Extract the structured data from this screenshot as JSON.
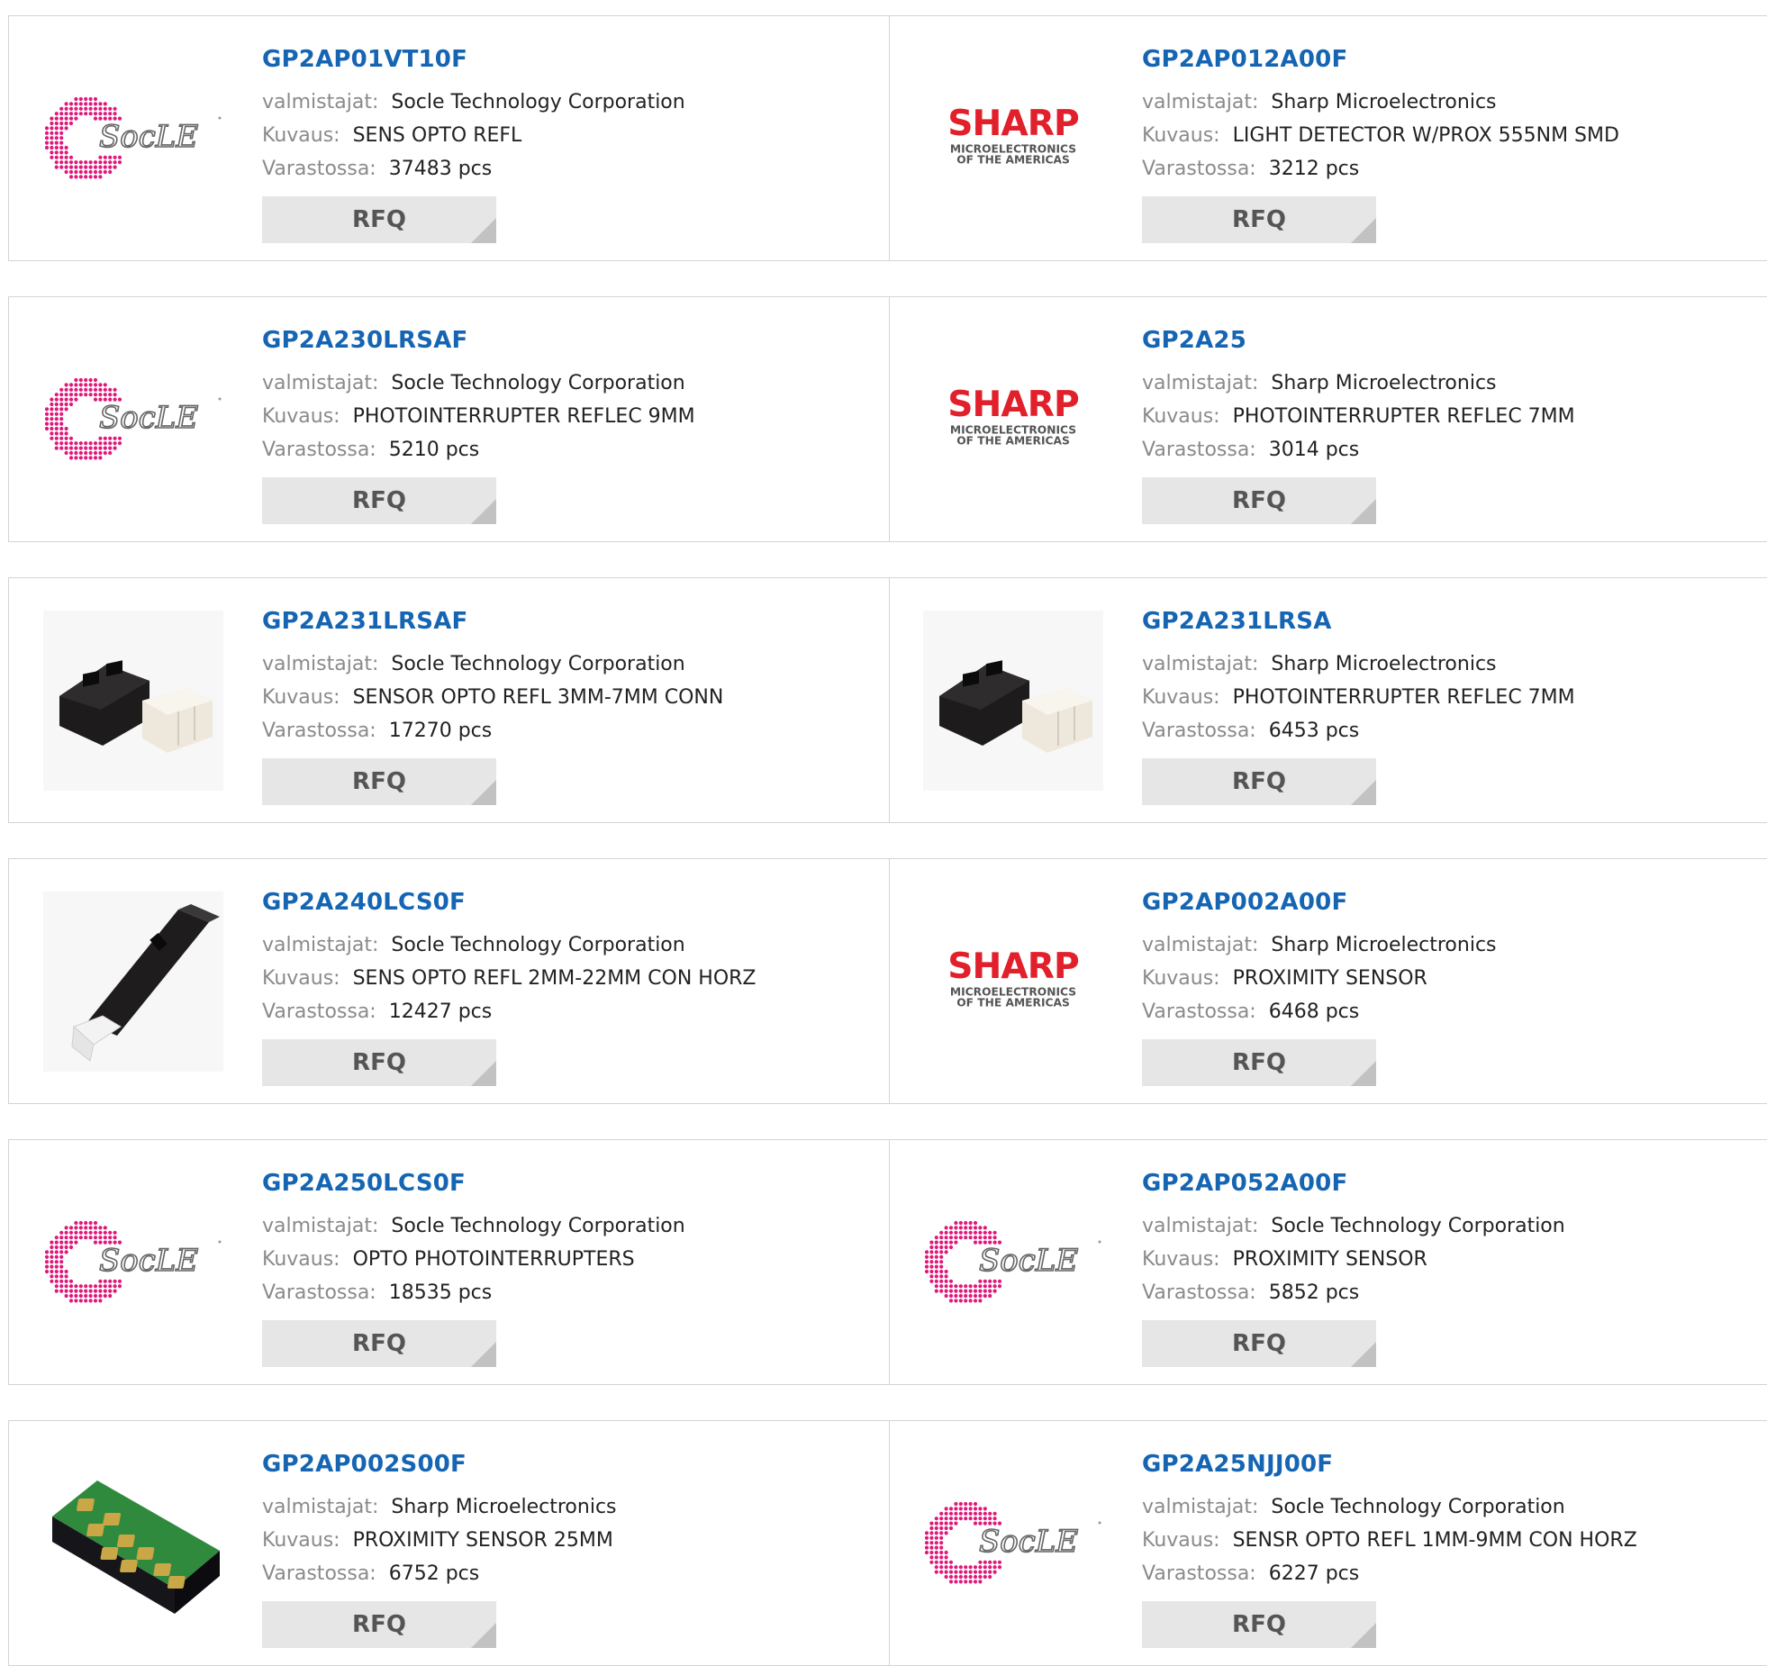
{
  "labels": {
    "manufacturer": "valmistajat:",
    "description": "Kuvaus:",
    "stock": "Varastossa:",
    "rfq": "RFQ"
  },
  "logos": {
    "socle": {
      "text": "SocLE",
      "dot_color": "#e0187a"
    },
    "sharp": {
      "word": "SHARP",
      "line1": "MICROELECTRONICS",
      "line2": "OF THE AMERICAS",
      "color": "#e1202b"
    }
  },
  "products": [
    {
      "pn": "GP2AP01VT10F",
      "manufacturer": "Socle Technology Corporation",
      "description": "SENS OPTO REFL",
      "stock": "37483 pcs",
      "image": "socle-logo"
    },
    {
      "pn": "GP2AP012A00F",
      "manufacturer": "Sharp Microelectronics",
      "description": "LIGHT DETECTOR W/PROX 555NM SMD",
      "stock": "3212 pcs",
      "image": "sharp-logo"
    },
    {
      "pn": "GP2A230LRSAF",
      "manufacturer": "Socle Technology Corporation",
      "description": "PHOTOINTERRUPTER REFLEC 9MM",
      "stock": "5210 pcs",
      "image": "socle-logo"
    },
    {
      "pn": "GP2A25",
      "manufacturer": "Sharp Microelectronics",
      "description": "PHOTOINTERRUPTER REFLEC 7MM",
      "stock": "3014 pcs",
      "image": "sharp-logo"
    },
    {
      "pn": "GP2A231LRSAF",
      "manufacturer": "Socle Technology Corporation",
      "description": "SENSOR OPTO REFL 3MM-7MM CONN",
      "stock": "17270 pcs",
      "image": "sensor-photo"
    },
    {
      "pn": "GP2A231LRSA",
      "manufacturer": "Sharp Microelectronics",
      "description": "PHOTOINTERRUPTER REFLEC 7MM",
      "stock": "6453 pcs",
      "image": "sensor-photo"
    },
    {
      "pn": "GP2A240LCS0F",
      "manufacturer": "Socle Technology Corporation",
      "description": "SENS OPTO REFL 2MM-22MM CON HORZ",
      "stock": "12427 pcs",
      "image": "long-sensor-photo"
    },
    {
      "pn": "GP2AP002A00F",
      "manufacturer": "Sharp Microelectronics",
      "description": "PROXIMITY SENSOR",
      "stock": "6468 pcs",
      "image": "sharp-logo"
    },
    {
      "pn": "GP2A250LCS0F",
      "manufacturer": "Socle Technology Corporation",
      "description": "OPTO PHOTOINTERRUPTERS",
      "stock": "18535 pcs",
      "image": "socle-logo"
    },
    {
      "pn": "GP2AP052A00F",
      "manufacturer": "Socle Technology Corporation",
      "description": "PROXIMITY SENSOR",
      "stock": "5852 pcs",
      "image": "socle-logo"
    },
    {
      "pn": "GP2AP002S00F",
      "manufacturer": "Sharp Microelectronics",
      "description": "PROXIMITY SENSOR 25MM",
      "stock": "6752 pcs",
      "image": "smd-chip-photo"
    },
    {
      "pn": "GP2A25NJJ00F",
      "manufacturer": "Socle Technology Corporation",
      "description": "SENSR OPTO REFL 1MM-9MM CON HORZ",
      "stock": "6227 pcs",
      "image": "socle-logo"
    }
  ]
}
